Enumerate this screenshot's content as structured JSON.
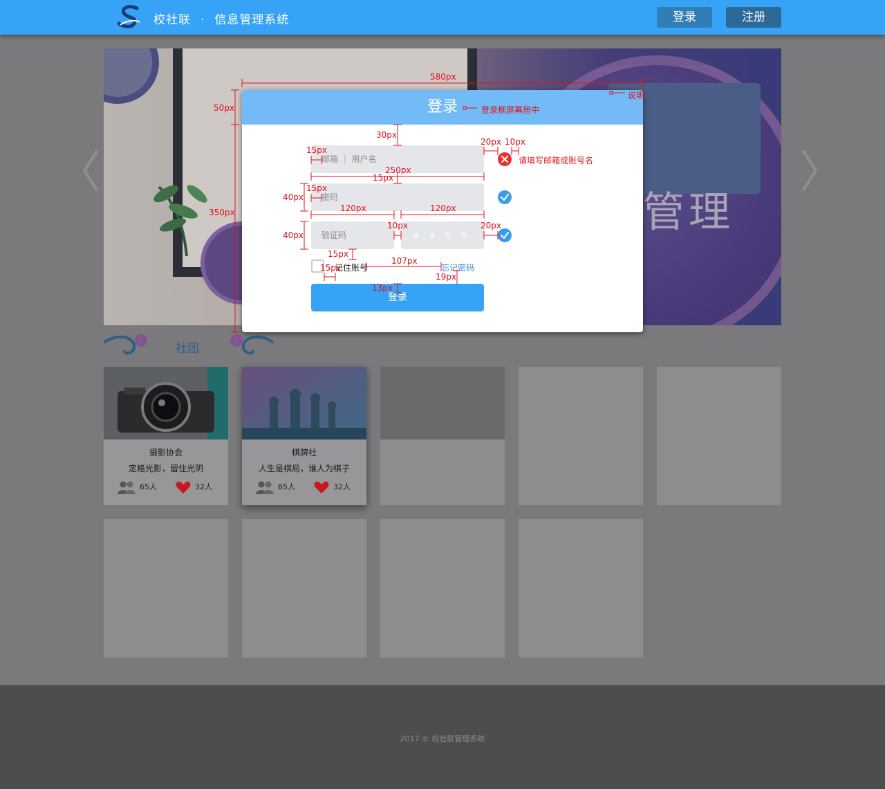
{
  "header": {
    "brand_name": "校社联",
    "brand_dot": "·",
    "brand_system": "信息管理系统",
    "login_label": "登录",
    "register_label": "注册"
  },
  "banner": {
    "big_text": "管理",
    "prev_arrow": "〈",
    "next_arrow": "〉"
  },
  "section": {
    "title": "社团"
  },
  "cards": [
    {
      "name": "摄影协会",
      "desc": "定格光影，留住光阴",
      "members": "65人",
      "likes": "32人"
    },
    {
      "name": "棋牌社",
      "desc": "人生是棋局，谁人为棋子",
      "members": "65人",
      "likes": "32人"
    }
  ],
  "footer": {
    "text": "2017 © 校社联管理系统"
  },
  "modal": {
    "title": "登录",
    "username_placeholder": "邮箱 ｜ 用户名",
    "password_placeholder": "密码",
    "code_placeholder": "验证码",
    "captcha": "a a b b",
    "error_text": "请填写邮箱或账号名",
    "remember_label": "记住账号",
    "forgot_label": "忘记密码",
    "submit_label": "登录"
  },
  "annotations": {
    "width_580": "580px",
    "height_50": "50px",
    "height_350": "350px",
    "note": "说明",
    "center_note": "登录框屏幕居中",
    "gap_30": "30px",
    "gap_20": "20px",
    "gap_10": "10px",
    "pad_15_a": "15px",
    "width_250": "250px",
    "gap_15_b": "15px",
    "pad_15_c": "15px",
    "height_40_a": "40px",
    "width_120_a": "120px",
    "width_120_b": "120px",
    "height_40_b": "40px",
    "gap_10_b": "10px",
    "gap_20_b": "20px",
    "gap_15_d": "15px",
    "width_107": "107px",
    "pad_15_e": "15px",
    "gap_19": "19px",
    "gap_13": "13px"
  },
  "colors": {
    "header": "#36a3f7",
    "modal_header": "#72bbf6",
    "error": "#e5322d",
    "ok": "#3c9be8",
    "annotation": "#e0101a"
  }
}
